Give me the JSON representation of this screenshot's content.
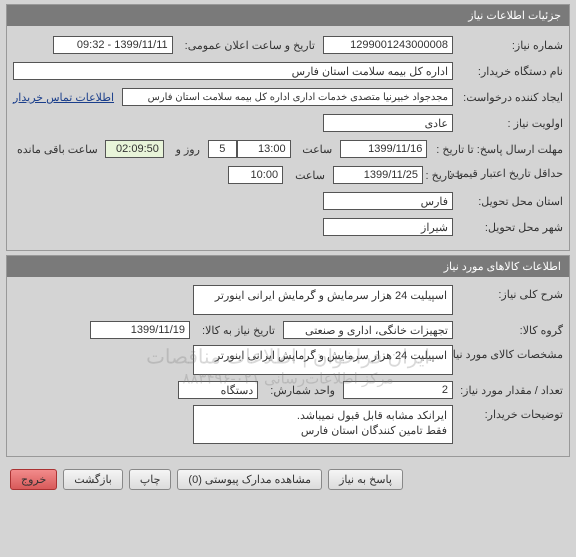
{
  "panel1": {
    "title": "جزئیات اطلاعات نیاز",
    "link": "اطلاعات تماس خریدار",
    "labels": {
      "need_no": "شماره نیاز:",
      "announce": "تاریخ و ساعت اعلان عمومی:",
      "buyer_org": "نام دستگاه خریدار:",
      "requester": "ایجاد کننده درخواست:",
      "priority": "اولویت نیاز :",
      "deadline_to": "مهلت ارسال پاسخ:  تا تاریخ :",
      "hour": "ساعت",
      "day_and": "روز و",
      "remaining": "ساعت باقی مانده",
      "min_credit": "حداقل تاریخ اعتبار قیمت:",
      "to_date": "تا تاریخ :",
      "province": "استان محل تحویل:",
      "city": "شهر محل تحویل:"
    },
    "values": {
      "need_no": "1299001243000008",
      "announce": "1399/11/11 - 09:32",
      "buyer_org": "اداره کل بیمه سلامت استان فارس",
      "requester": "مجدجواد خبیرنیا متصدی خدمات اداری اداره کل بیمه سلامت استان فارس",
      "priority": "عادی",
      "deadline_date": "1399/11/16",
      "deadline_time": "13:00",
      "remaining_days": "5",
      "remaining_time": "02:09:50",
      "credit_date": "1399/11/25",
      "credit_time": "10:00",
      "province": "فارس",
      "city": "شیراز"
    }
  },
  "panel2": {
    "title": "اطلاعات کالاهای مورد نیاز",
    "labels": {
      "general_desc": "شرح کلی نیاز:",
      "goods_group": "گروه کالا:",
      "need_date": "تاریخ نیاز به کالا:",
      "goods_spec": "مشخصات کالای مورد نیاز:",
      "qty": "تعداد / مقدار مورد نیاز:",
      "unit": "واحد شمارش:",
      "buyer_notes": "توضیحات خریدار:"
    },
    "values": {
      "general_desc": "اسپیلیت 24 هزار سرمایش و گرمایش ایرانی اینورتر",
      "goods_group": "تجهیزات خانگی، اداری و صنعتی",
      "need_date": "1399/11/19",
      "goods_spec": "اسپیلیت 24 هزار سرمایش و گرمایش ایرانی اینورتر",
      "qty": "2",
      "unit": "دستگاه",
      "buyer_notes": "ایرانکد مشابه قابل قبول نمیباشد.\nفقط تامین کنندگان استان فارس"
    },
    "watermark_line1": "ایران فراخوان | اطلاعات مناقصات",
    "watermark_line2": "مرکز اطلاعات‌رسانی ۰۲۱-۸۸۳۴۹۶"
  },
  "buttons": {
    "reply": "پاسخ به نیاز",
    "attachments": "مشاهده مدارک پیوستی  (0)",
    "print": "چاپ",
    "back": "بازگشت",
    "exit": "خروج"
  }
}
